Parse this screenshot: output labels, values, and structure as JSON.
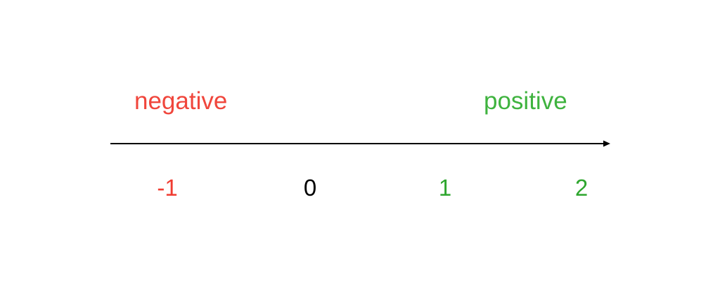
{
  "diagram": {
    "labels": {
      "negative": {
        "text": "negative",
        "color": "#f0463c"
      },
      "positive": {
        "text": "positive",
        "color": "#3fb33f"
      }
    },
    "axis_color": "#000000",
    "ticks": [
      {
        "text": "-1",
        "color": "#f03c32"
      },
      {
        "text": "0",
        "color": "#000000"
      },
      {
        "text": "1",
        "color": "#2ea62e"
      },
      {
        "text": "2",
        "color": "#2ea62e"
      }
    ]
  }
}
